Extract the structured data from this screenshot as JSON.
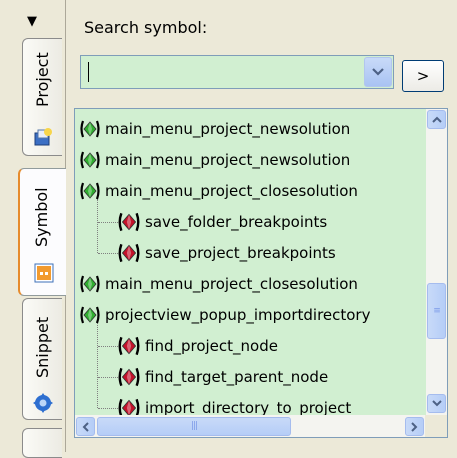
{
  "tabs": {
    "menu_glyph": "▼",
    "items": [
      {
        "id": "project",
        "label": "Project",
        "icon": "project-icon"
      },
      {
        "id": "symbol",
        "label": "Symbol",
        "icon": "symbol-icon",
        "active": true
      },
      {
        "id": "snippet",
        "label": "Snippet",
        "icon": "snippet-gear-icon"
      }
    ]
  },
  "search": {
    "label": "Search symbol:",
    "value": "",
    "dropdown_icon": "chevron-down-icon",
    "go_label": ">"
  },
  "tree": {
    "rows": [
      {
        "text": "main_menu_project_newsolution",
        "kind": "green",
        "level": 0
      },
      {
        "text": "main_menu_project_newsolution",
        "kind": "green",
        "level": 0
      },
      {
        "text": "main_menu_project_closesolution",
        "kind": "green",
        "level": 0
      },
      {
        "text": "save_folder_breakpoints",
        "kind": "red",
        "level": 1
      },
      {
        "text": "save_project_breakpoints",
        "kind": "red",
        "level": 1
      },
      {
        "text": "main_menu_project_closesolution",
        "kind": "green",
        "level": 0
      },
      {
        "text": "projectview_popup_importdirectory",
        "kind": "green",
        "level": 0
      },
      {
        "text": "find_project_node",
        "kind": "red",
        "level": 1
      },
      {
        "text": "find_target_parent_node",
        "kind": "red",
        "level": 1
      },
      {
        "text": "import_directory_to_project",
        "kind": "red",
        "level": 1
      }
    ]
  },
  "colors": {
    "panel_bg": "#d1efd1",
    "accent_tab": "#e68b2c",
    "green_symbol": "#2fae2f",
    "red_symbol": "#c4122a"
  },
  "scrollbars": {
    "vertical_position": 0.62,
    "horizontal_position": 0.0
  }
}
